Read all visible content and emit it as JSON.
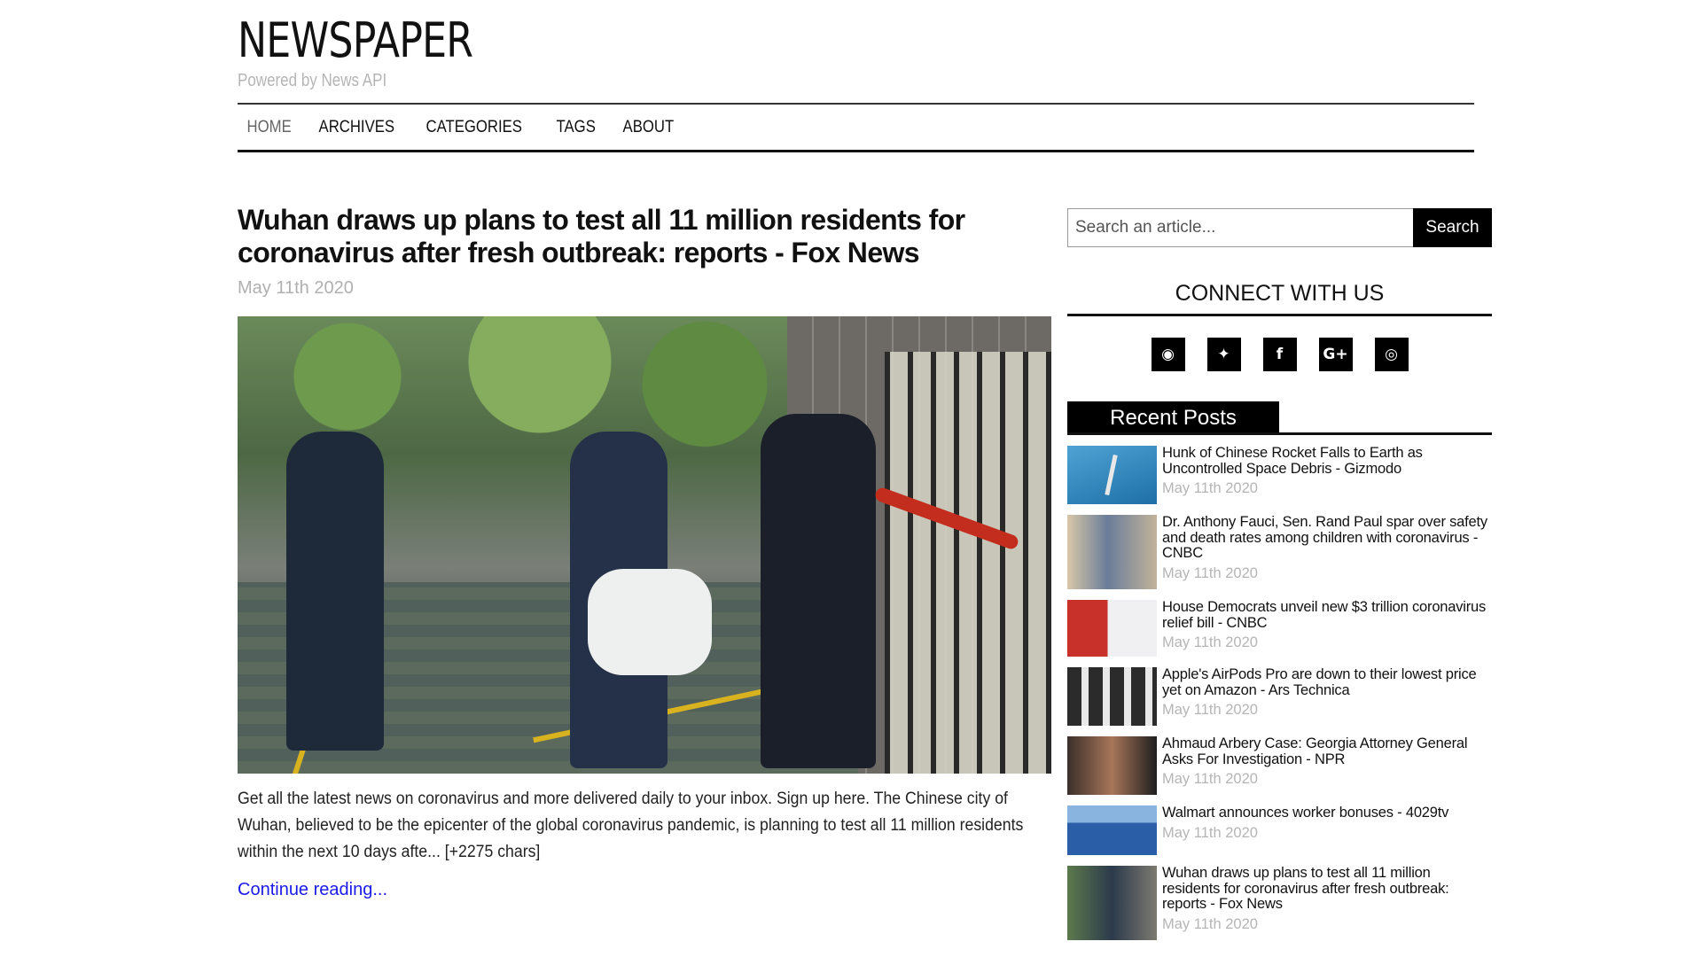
{
  "site": {
    "title": "NEWSPAPER",
    "tagline": "Powered by News API"
  },
  "nav": {
    "items": [
      {
        "label": "HOME",
        "active": true
      },
      {
        "label": "ARCHIVES"
      },
      {
        "label": "CATEGORIES"
      },
      {
        "label": "TAGS"
      },
      {
        "label": "ABOUT"
      }
    ]
  },
  "article": {
    "title": "Wuhan draws up plans to test all 11 million residents for coronavirus after fresh outbreak: reports - Fox News",
    "date": "May 11th 2020",
    "image_icon": "news-photo",
    "body": "Get all the latest news on coronavirus and more delivered daily to your inbox. Sign up here. The Chinese city of Wuhan, believed to be the epicenter of the global coronavirus pandemic, is planning to test all 11 million residents within the next 10 days afte... [+2275 chars]",
    "continue_label": "Continue reading..."
  },
  "sidebar": {
    "search": {
      "placeholder": "Search an article...",
      "button_label": "Search"
    },
    "connect_title": "CONNECT WITH US",
    "social": [
      {
        "icon": "github-icon",
        "glyph": "◉"
      },
      {
        "icon": "twitter-icon",
        "glyph": "✦"
      },
      {
        "icon": "facebook-icon",
        "glyph": "f"
      },
      {
        "icon": "google-plus-icon",
        "glyph": "G+"
      },
      {
        "icon": "instagram-icon",
        "glyph": "◎"
      }
    ],
    "recent_title": "Recent Posts",
    "recent_posts": [
      {
        "title": "Hunk of Chinese Rocket Falls to Earth as Uncontrolled Space Debris - Gizmodo",
        "date": "May 11th 2020"
      },
      {
        "title": "Dr. Anthony Fauci, Sen. Rand Paul spar over safety and death rates among children with coronavirus - CNBC",
        "date": "May 11th 2020"
      },
      {
        "title": "House Democrats unveil new $3 trillion coronavirus relief bill - CNBC",
        "date": "May 11th 2020"
      },
      {
        "title": "Apple's AirPods Pro are down to their lowest price yet on Amazon - Ars Technica",
        "date": "May 11th 2020"
      },
      {
        "title": "Ahmaud Arbery Case: Georgia Attorney General Asks For Investigation - NPR",
        "date": "May 11th 2020"
      },
      {
        "title": "Walmart announces worker bonuses - 4029tv",
        "date": "May 11th 2020"
      },
      {
        "title": "Wuhan draws up plans to test all 11 million residents for coronavirus after fresh outbreak: reports - Fox News",
        "date": "May 11th 2020"
      }
    ]
  },
  "colors": {
    "text": "#111111",
    "muted": "#b5b5b5",
    "link": "#1a1ae6",
    "accent": "#000000"
  }
}
